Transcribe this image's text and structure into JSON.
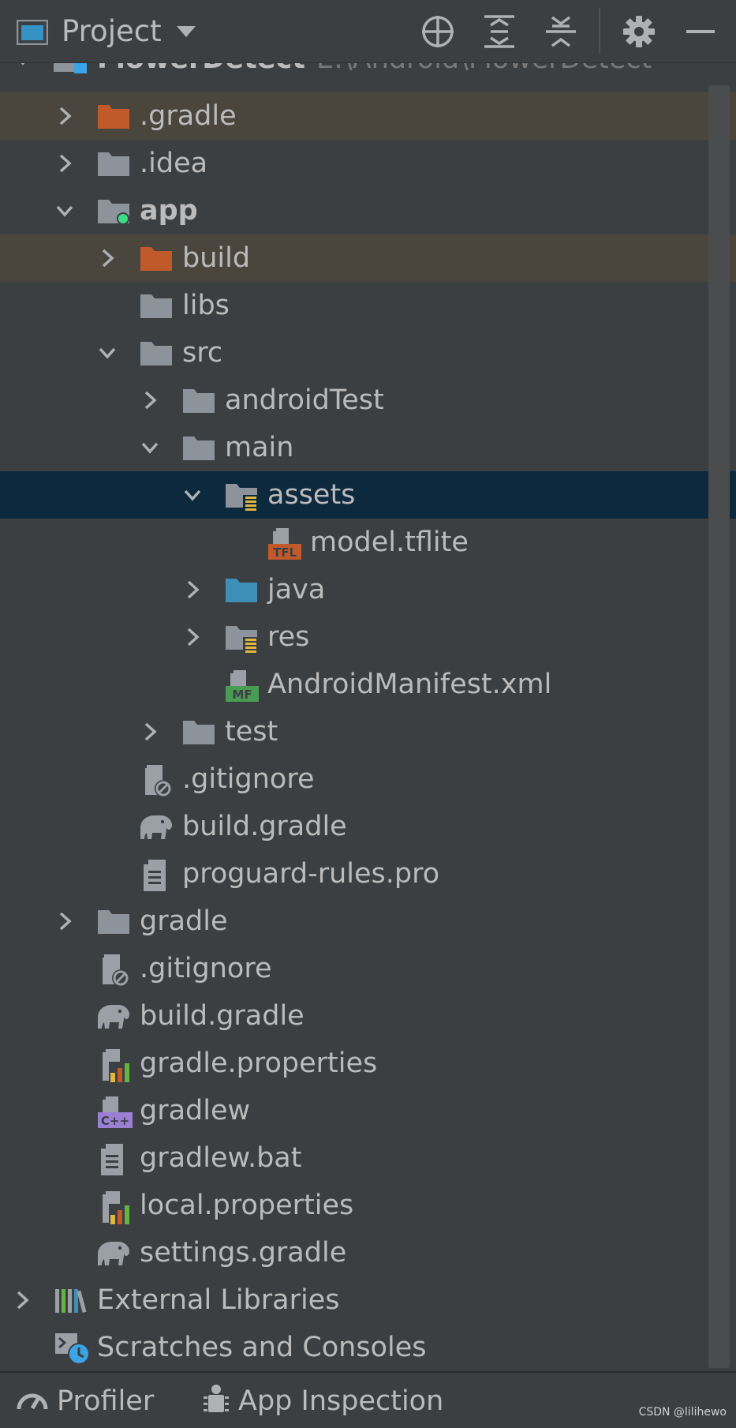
{
  "toolbar": {
    "title": "Project",
    "icons": [
      "project-window-icon",
      "dropdown-icon",
      "locate-icon",
      "expand-all-icon",
      "collapse-all-icon",
      "settings-icon",
      "minimize-icon"
    ]
  },
  "tree": {
    "root": {
      "label": "FlowerDetect",
      "path": "E:\\Android\\FlowerDetect"
    },
    "items": [
      {
        "label": ".gradle"
      },
      {
        "label": ".idea"
      },
      {
        "label": "app"
      },
      {
        "label": "build"
      },
      {
        "label": "libs"
      },
      {
        "label": "src"
      },
      {
        "label": "androidTest"
      },
      {
        "label": "main"
      },
      {
        "label": "assets"
      },
      {
        "label": "model.tflite"
      },
      {
        "label": "java"
      },
      {
        "label": "res"
      },
      {
        "label": "AndroidManifest.xml"
      },
      {
        "label": "test"
      },
      {
        "label": ".gitignore"
      },
      {
        "label": "build.gradle"
      },
      {
        "label": "proguard-rules.pro"
      },
      {
        "label": "gradle"
      },
      {
        "label": ".gitignore"
      },
      {
        "label": "build.gradle"
      },
      {
        "label": "gradle.properties"
      },
      {
        "label": "gradlew"
      },
      {
        "label": "gradlew.bat"
      },
      {
        "label": "local.properties"
      },
      {
        "label": "settings.gradle"
      },
      {
        "label": "External Libraries"
      },
      {
        "label": "Scratches and Consoles"
      }
    ],
    "badges": {
      "tflite": "TFL",
      "manifest": "MF",
      "cpp": "C++"
    }
  },
  "bottombar": {
    "profiler": "Profiler",
    "app_inspection": "App Inspection"
  },
  "watermark": "CSDN @lilihewo",
  "colors": {
    "background": "#3c3f41",
    "selection": "#0d293e",
    "excluded_highlight": "#4a463e",
    "folder_gray": "#8c939a",
    "folder_orange": "#c05a2a",
    "folder_blue": "#3e8fb7"
  }
}
